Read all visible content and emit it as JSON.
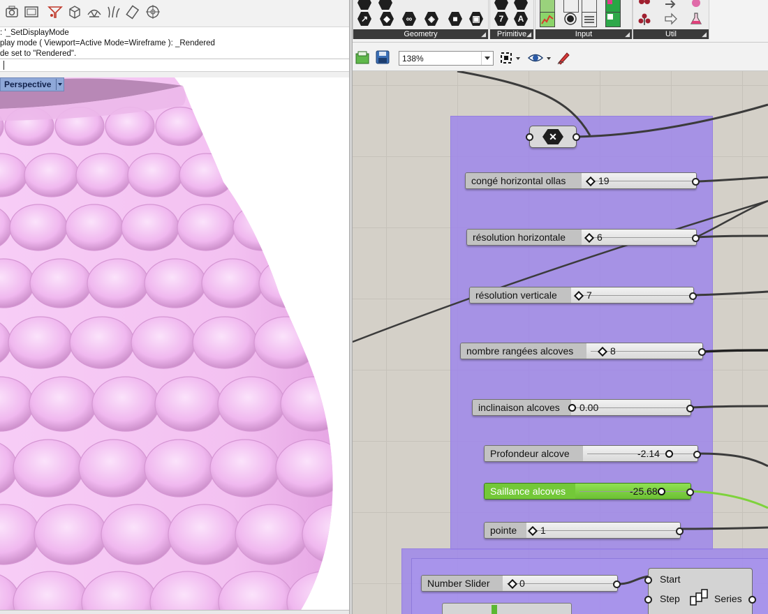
{
  "rhino": {
    "command_history": [
      ": '_SetDisplayMode",
      "play mode ( Viewport=Active  Mode=Wireframe ): _Rendered",
      "de set to \"Rendered\"."
    ],
    "viewport_label": "Perspective",
    "icons": [
      "camera-icon",
      "window-icon",
      "filter-icon",
      "box-icon",
      "mesh-icon",
      "grass-icon",
      "eraser-icon",
      "target-icon"
    ]
  },
  "grasshopper": {
    "ribbon": {
      "panels": [
        {
          "label": "Geometry",
          "icons": [
            "arrow-icon",
            "shape-icon",
            "link-icon",
            "box-icon",
            "box-param-icon",
            "brep-icon"
          ]
        },
        {
          "label": "Primitive",
          "icons": [
            "integer-icon",
            "text-icon"
          ]
        },
        {
          "label": "Input",
          "icons": [
            "gradient-icon",
            "toggle-icon",
            "panel-icon",
            "colour-swatch-icon",
            "image-sampler-icon"
          ]
        },
        {
          "label": "Util",
          "icons": [
            "tree-icon",
            "arrow-right-icon",
            "flask-icon"
          ]
        }
      ]
    },
    "toolbar": {
      "zoom": "138%"
    },
    "sliders": [
      {
        "name": "congé horizontal ollas",
        "value": "19"
      },
      {
        "name": "résolution horizontale",
        "value": "6"
      },
      {
        "name": "résolution verticale",
        "value": "7"
      },
      {
        "name": "nombre rangées alcoves",
        "value": "8"
      },
      {
        "name": "inclinaison alcoves",
        "value": "0.00"
      },
      {
        "name": "Profondeur alcove",
        "value": "-2.14"
      },
      {
        "name": "Saillance alcoves",
        "value": "-25.68"
      },
      {
        "name": "pointe",
        "value": "1"
      }
    ],
    "bottom_slider": {
      "name": "Number Slider",
      "value": "0"
    },
    "series": {
      "inputs": [
        "Start",
        "Step"
      ],
      "output": "Series"
    },
    "colors": {
      "canvas": "#d4d0c8",
      "group": "#9c84ec",
      "active_slider": "#73c838",
      "wire": "#4a4a4a",
      "active_wire": "#7ed23c"
    }
  }
}
